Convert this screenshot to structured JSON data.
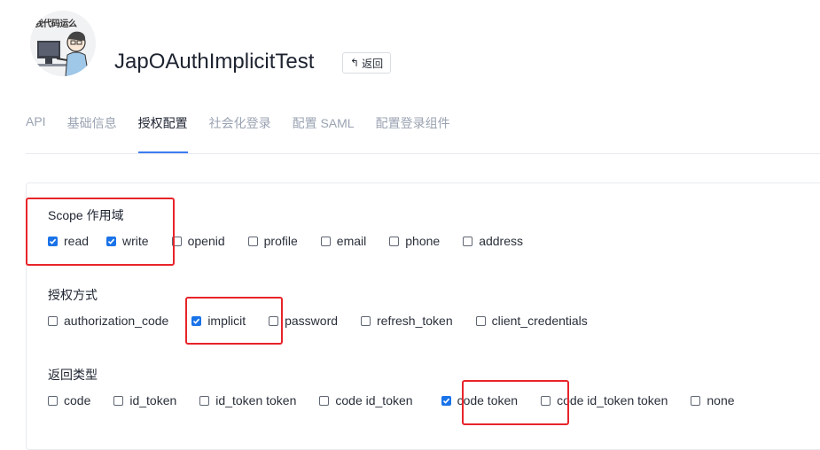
{
  "header": {
    "avatar_caption": "我代码运么",
    "app_name": "JapOAuthImplicitTest",
    "back_label": "返回"
  },
  "tabs": [
    {
      "label": "API",
      "active": false
    },
    {
      "label": "基础信息",
      "active": false
    },
    {
      "label": "授权配置",
      "active": true
    },
    {
      "label": "社会化登录",
      "active": false
    },
    {
      "label": "配置 SAML",
      "active": false
    },
    {
      "label": "配置登录组件",
      "active": false
    }
  ],
  "scope": {
    "label": "Scope 作用域",
    "options": [
      {
        "label": "read",
        "checked": true
      },
      {
        "label": "write",
        "checked": true
      },
      {
        "label": "openid",
        "checked": false
      },
      {
        "label": "profile",
        "checked": false
      },
      {
        "label": "email",
        "checked": false
      },
      {
        "label": "phone",
        "checked": false
      },
      {
        "label": "address",
        "checked": false
      }
    ]
  },
  "grant_types": {
    "label": "授权方式",
    "options": [
      {
        "label": "authorization_code",
        "checked": false
      },
      {
        "label": "implicit",
        "checked": true
      },
      {
        "label": "password",
        "checked": false
      },
      {
        "label": "refresh_token",
        "checked": false
      },
      {
        "label": "client_credentials",
        "checked": false
      }
    ]
  },
  "response_types": {
    "label": "返回类型",
    "options": [
      {
        "label": "code",
        "checked": false
      },
      {
        "label": "id_token",
        "checked": false
      },
      {
        "label": "id_token token",
        "checked": false
      },
      {
        "label": "code id_token",
        "checked": false
      },
      {
        "label": "code token",
        "checked": true
      },
      {
        "label": "code id_token token",
        "checked": false
      },
      {
        "label": "none",
        "checked": false
      }
    ]
  },
  "colors": {
    "accent": "#1a73e8",
    "tab_underline": "#3d7cf0",
    "highlight_box": "#e8242a"
  }
}
